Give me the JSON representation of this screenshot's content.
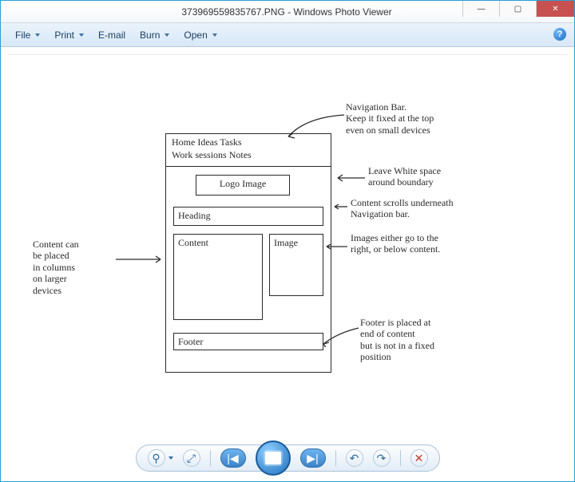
{
  "window": {
    "title": "373969559835767.PNG - Windows Photo Viewer"
  },
  "menu": {
    "file": "File",
    "print": "Print",
    "email": "E-mail",
    "burn": "Burn",
    "open": "Open",
    "help_glyph": "?"
  },
  "image_content": {
    "annotations": {
      "nav": "Navigation Bar.\nKeep it fixed at the top\neven on small devices",
      "whitespace": "Leave White space\naround boundary",
      "scroll": "Content scrolls underneath\nNavigation bar.",
      "images": "Images either go to the\nright, or below content.",
      "columns": "Content can\nbe placed\nin columns\non larger\ndevices",
      "footer": "Footer is placed at\nend of content\nbut is not in a fixed\nposition"
    },
    "wireframe": {
      "nav_row1": "Home   Ideas   Tasks",
      "nav_row2": "Work sessions    Notes",
      "logo": "Logo Image",
      "heading": "Heading",
      "content": "Content",
      "image": "Image",
      "footer": "Footer"
    }
  },
  "toolbar": {
    "zoom": "⚲",
    "fit": "⤢",
    "prev": "|◀",
    "play_inner": "",
    "next": "▶|",
    "ccw": "↶",
    "cw": "↷",
    "delete": "✕"
  }
}
